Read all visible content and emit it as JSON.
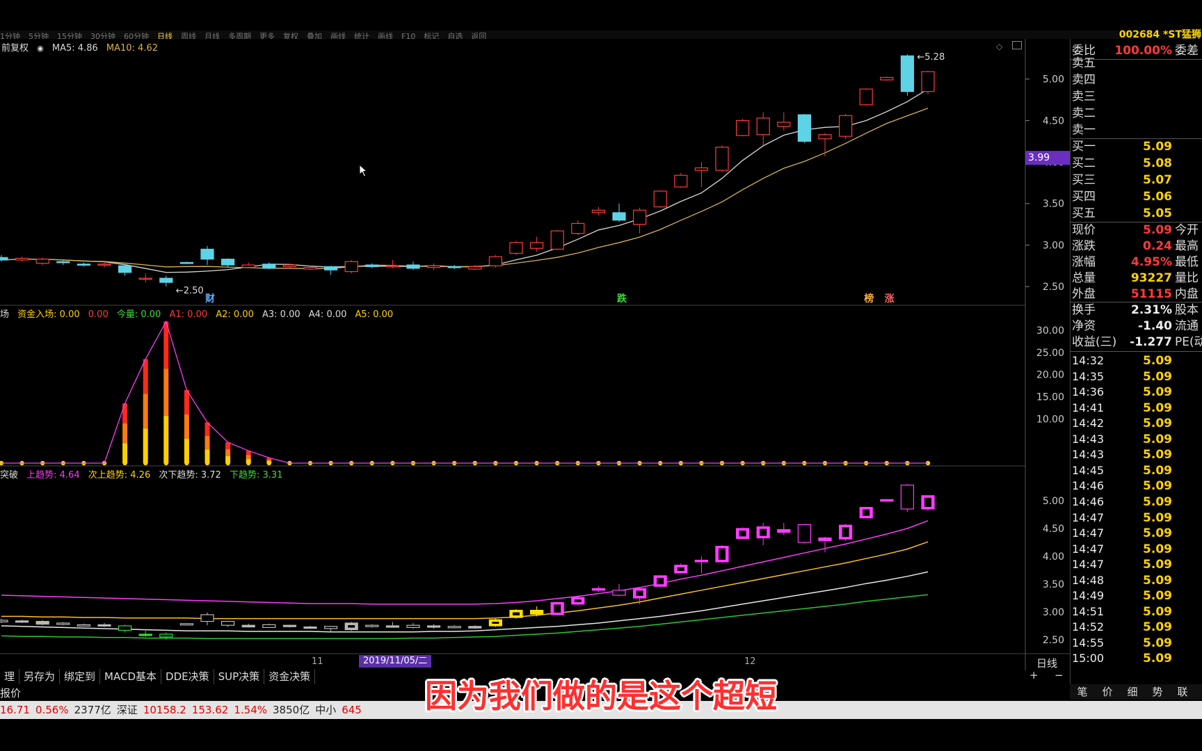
{
  "app": {
    "toolbar_left": [
      "1分钟",
      "5分钟",
      "15分钟",
      "30分钟",
      "60分钟",
      "日线",
      "周线",
      "月线",
      "多周期",
      "更多"
    ],
    "toolbar_active": "日线",
    "toolbar_right": [
      "复权",
      "叠加",
      "画线",
      "统计",
      "画线",
      "F10",
      "标记",
      "自选",
      "返回"
    ],
    "stock_code": "002684 *ST猛狮"
  },
  "colors": {
    "up": "#ff3b3b",
    "down": "#5fd3e6",
    "ma5": "#d8d8d8",
    "ma10": "#d9b44a",
    "magenta": "#ff3bff",
    "yellow": "#ffe000",
    "bg": "#000000"
  },
  "main_panel": {
    "legend": {
      "mode": "前复权",
      "ma5": "MA5: 4.86",
      "ma10": "MA10: 4.62"
    },
    "yaxis": [
      "5.00",
      "4.50",
      "4.00",
      "3.50",
      "3.00",
      "2.50"
    ],
    "high_label": "5.28",
    "low_label": "2.50",
    "current_price_tag": "3.99",
    "event_markers": [
      "财",
      "跌",
      "榜",
      "涨"
    ]
  },
  "money_panel": {
    "legend": {
      "prefix": "场",
      "a": "资金入场: 0.00",
      "b": "0.00",
      "c": "今量: 0.00",
      "a1": "A1: 0.00",
      "a2": "A2: 0.00",
      "a3": "A3: 0.00",
      "a4": "A4: 0.00",
      "a5": "A5: 0.00"
    },
    "yaxis": [
      "30.00",
      "25.00",
      "20.00",
      "15.00",
      "10.00"
    ]
  },
  "trend_panel": {
    "legend": {
      "prefix": "突破",
      "up": "上趋势: 4.64",
      "up2": "次上趋势: 4.26",
      "down2": "次下趋势: 3.72",
      "down": "下趋势: 3.31"
    },
    "yaxis": [
      "5.00",
      "4.50",
      "4.00",
      "3.50",
      "3.00",
      "2.50"
    ]
  },
  "xaxis": {
    "m11": "11",
    "m12": "12",
    "date_tag": "2019/11/05/二",
    "period": "日线"
  },
  "tabs": [
    "理",
    "另存为",
    "绑定到",
    "MACD基本",
    "DDE决策",
    "SUP决策",
    "资金决策"
  ],
  "zoom": [
    "+",
    "−"
  ],
  "bottom_left_label": "报价",
  "side": {
    "weibi": {
      "label": "委比",
      "value": "100.00%",
      "extra": "委差"
    },
    "sell": [
      {
        "label": "卖五",
        "price": ""
      },
      {
        "label": "卖四",
        "price": ""
      },
      {
        "label": "卖三",
        "price": ""
      },
      {
        "label": "卖二",
        "price": ""
      },
      {
        "label": "卖一",
        "price": ""
      }
    ],
    "buy": [
      {
        "label": "买一",
        "price": "5.09"
      },
      {
        "label": "买二",
        "price": "5.08"
      },
      {
        "label": "买三",
        "price": "5.07"
      },
      {
        "label": "买四",
        "price": "5.06"
      },
      {
        "label": "买五",
        "price": "5.05"
      }
    ],
    "quote": [
      {
        "label": "现价",
        "value": "5.09",
        "extra": "今开",
        "color": "#ff3b3b"
      },
      {
        "label": "涨跌",
        "value": "0.24",
        "extra": "最高",
        "color": "#ff3b3b"
      },
      {
        "label": "涨幅",
        "value": "4.95%",
        "extra": "最低",
        "color": "#ff3b3b"
      },
      {
        "label": "总量",
        "value": "93227",
        "extra": "量比",
        "color": "#ffd400"
      },
      {
        "label": "外盘",
        "value": "51115",
        "extra": "内盘",
        "color": "#ff3b3b"
      }
    ],
    "stats": [
      {
        "label": "换手",
        "value": "2.31%",
        "extra": "股本",
        "color": "#eeeeee"
      },
      {
        "label": "净资",
        "value": "-1.40",
        "extra": "流通",
        "color": "#eeeeee"
      },
      {
        "label": "收益(三)",
        "value": "-1.277",
        "extra": "PE(动",
        "color": "#eeeeee"
      }
    ],
    "trades": [
      {
        "time": "14:32",
        "price": "5.09"
      },
      {
        "time": "14:35",
        "price": "5.09"
      },
      {
        "time": "14:36",
        "price": "5.09"
      },
      {
        "time": "14:41",
        "price": "5.09"
      },
      {
        "time": "14:42",
        "price": "5.09"
      },
      {
        "time": "14:43",
        "price": "5.09"
      },
      {
        "time": "14:43",
        "price": "5.09"
      },
      {
        "time": "14:45",
        "price": "5.09"
      },
      {
        "time": "14:46",
        "price": "5.09"
      },
      {
        "time": "14:46",
        "price": "5.09"
      },
      {
        "time": "14:47",
        "price": "5.09"
      },
      {
        "time": "14:47",
        "price": "5.09"
      },
      {
        "time": "14:47",
        "price": "5.09"
      },
      {
        "time": "14:47",
        "price": "5.09"
      },
      {
        "time": "14:48",
        "price": "5.09"
      },
      {
        "time": "14:49",
        "price": "5.09"
      },
      {
        "time": "14:51",
        "price": "5.09"
      },
      {
        "time": "14:52",
        "price": "5.09"
      },
      {
        "time": "14:55",
        "price": "5.09"
      },
      {
        "time": "15:00",
        "price": "5.09"
      }
    ],
    "bottom_tabs": [
      "笔",
      "价",
      "细",
      "势",
      "联"
    ]
  },
  "ticker": [
    {
      "text": "16.71",
      "color": "#e00000"
    },
    {
      "text": "0.56%",
      "color": "#e00000"
    },
    {
      "text": "2377亿",
      "color": "#222222"
    },
    {
      "text": "深证",
      "color": "#222222"
    },
    {
      "text": "10158.2",
      "color": "#e00000"
    },
    {
      "text": "153.62",
      "color": "#e00000"
    },
    {
      "text": "1.54%",
      "color": "#e00000"
    },
    {
      "text": "3850亿",
      "color": "#222222"
    },
    {
      "text": "中小",
      "color": "#222222"
    },
    {
      "text": "645",
      "color": "#e00000"
    }
  ],
  "subtitle": "因为我们做的是这个超短",
  "chart_data": {
    "type": "candlestick",
    "ylim": [
      2.4,
      5.4
    ],
    "candles": [
      {
        "o": 2.85,
        "c": 2.82,
        "h": 2.88,
        "l": 2.8
      },
      {
        "o": 2.82,
        "c": 2.84,
        "h": 2.86,
        "l": 2.8
      },
      {
        "o": 2.78,
        "c": 2.83,
        "h": 2.85,
        "l": 2.76
      },
      {
        "o": 2.8,
        "c": 2.79,
        "h": 2.82,
        "l": 2.76
      },
      {
        "o": 2.77,
        "c": 2.76,
        "h": 2.79,
        "l": 2.74
      },
      {
        "o": 2.76,
        "c": 2.77,
        "h": 2.8,
        "l": 2.73
      },
      {
        "o": 2.75,
        "c": 2.67,
        "h": 2.77,
        "l": 2.63
      },
      {
        "o": 2.6,
        "c": 2.6,
        "h": 2.66,
        "l": 2.55
      },
      {
        "o": 2.6,
        "c": 2.55,
        "h": 2.63,
        "l": 2.5
      },
      {
        "o": 2.79,
        "c": 2.78,
        "h": 2.8,
        "l": 2.78
      },
      {
        "o": 2.95,
        "c": 2.83,
        "h": 2.99,
        "l": 2.76
      },
      {
        "o": 2.83,
        "c": 2.76,
        "h": 2.84,
        "l": 2.73
      },
      {
        "o": 2.73,
        "c": 2.76,
        "h": 2.79,
        "l": 2.72
      },
      {
        "o": 2.77,
        "c": 2.72,
        "h": 2.79,
        "l": 2.71
      },
      {
        "o": 2.74,
        "c": 2.76,
        "h": 2.77,
        "l": 2.72
      },
      {
        "o": 2.71,
        "c": 2.73,
        "h": 2.75,
        "l": 2.7
      },
      {
        "o": 2.74,
        "c": 2.7,
        "h": 2.75,
        "l": 2.64
      },
      {
        "o": 2.68,
        "c": 2.8,
        "h": 2.82,
        "l": 2.66
      },
      {
        "o": 2.76,
        "c": 2.74,
        "h": 2.78,
        "l": 2.72
      },
      {
        "o": 2.75,
        "c": 2.75,
        "h": 2.82,
        "l": 2.72
      },
      {
        "o": 2.76,
        "c": 2.72,
        "h": 2.8,
        "l": 2.7
      },
      {
        "o": 2.73,
        "c": 2.75,
        "h": 2.78,
        "l": 2.7
      },
      {
        "o": 2.74,
        "c": 2.73,
        "h": 2.76,
        "l": 2.71
      },
      {
        "o": 2.71,
        "c": 2.74,
        "h": 2.76,
        "l": 2.7
      },
      {
        "o": 2.75,
        "c": 2.86,
        "h": 2.88,
        "l": 2.73
      },
      {
        "o": 2.9,
        "c": 3.03,
        "h": 3.05,
        "l": 2.88
      },
      {
        "o": 2.96,
        "c": 3.03,
        "h": 3.1,
        "l": 2.92
      },
      {
        "o": 2.95,
        "c": 3.17,
        "h": 3.18,
        "l": 2.94
      },
      {
        "o": 3.14,
        "c": 3.26,
        "h": 3.3,
        "l": 3.12
      },
      {
        "o": 3.39,
        "c": 3.42,
        "h": 3.46,
        "l": 3.36
      },
      {
        "o": 3.39,
        "c": 3.3,
        "h": 3.5,
        "l": 3.28
      },
      {
        "o": 3.25,
        "c": 3.42,
        "h": 3.45,
        "l": 3.14
      },
      {
        "o": 3.46,
        "c": 3.65,
        "h": 3.66,
        "l": 3.45
      },
      {
        "o": 3.7,
        "c": 3.84,
        "h": 3.87,
        "l": 3.69
      },
      {
        "o": 3.9,
        "c": 3.93,
        "h": 4.0,
        "l": 3.7
      },
      {
        "o": 3.9,
        "c": 4.18,
        "h": 4.2,
        "l": 3.88
      },
      {
        "o": 4.32,
        "c": 4.5,
        "h": 4.52,
        "l": 4.31
      },
      {
        "o": 4.33,
        "c": 4.53,
        "h": 4.6,
        "l": 4.2
      },
      {
        "o": 4.43,
        "c": 4.48,
        "h": 4.6,
        "l": 4.38
      },
      {
        "o": 4.57,
        "c": 4.25,
        "h": 4.58,
        "l": 4.23
      },
      {
        "o": 4.28,
        "c": 4.33,
        "h": 4.35,
        "l": 4.07
      },
      {
        "o": 4.31,
        "c": 4.56,
        "h": 4.58,
        "l": 4.28
      },
      {
        "o": 4.69,
        "c": 4.88,
        "h": 4.89,
        "l": 4.68
      },
      {
        "o": 4.99,
        "c": 5.02,
        "h": 5.03,
        "l": 4.98
      },
      {
        "o": 5.28,
        "c": 4.85,
        "h": 5.3,
        "l": 4.8
      },
      {
        "o": 4.85,
        "c": 5.09,
        "h": 5.1,
        "l": 4.82
      }
    ],
    "money_values": [
      0,
      0,
      0,
      0,
      0,
      0,
      13.5,
      23.5,
      32,
      16.5,
      9.2,
      4.7,
      2.8,
      1.2,
      0,
      0,
      0,
      0,
      0,
      0,
      0,
      0,
      0,
      0,
      0,
      0,
      0,
      0,
      0,
      0,
      0,
      0,
      0,
      0,
      0,
      0,
      0,
      0,
      0,
      0,
      0,
      0,
      0,
      0,
      0,
      0
    ],
    "trend_lines": {
      "up_trend": [
        3.3,
        3.29,
        3.28,
        3.27,
        3.26,
        3.25,
        3.24,
        3.23,
        3.22,
        3.21,
        3.2,
        3.19,
        3.18,
        3.17,
        3.16,
        3.15,
        3.15,
        3.15,
        3.14,
        3.14,
        3.14,
        3.14,
        3.14,
        3.14,
        3.15,
        3.17,
        3.2,
        3.24,
        3.28,
        3.33,
        3.38,
        3.44,
        3.51,
        3.59,
        3.66,
        3.74,
        3.82,
        3.9,
        3.98,
        4.06,
        4.14,
        4.22,
        4.31,
        4.4,
        4.5,
        4.64
      ],
      "up2_trend": [
        2.92,
        2.92,
        2.91,
        2.91,
        2.9,
        2.9,
        2.89,
        2.89,
        2.89,
        2.89,
        2.88,
        2.88,
        2.88,
        2.88,
        2.88,
        2.88,
        2.88,
        2.88,
        2.88,
        2.88,
        2.88,
        2.88,
        2.88,
        2.88,
        2.89,
        2.91,
        2.94,
        2.98,
        3.02,
        3.07,
        3.12,
        3.18,
        3.25,
        3.32,
        3.39,
        3.46,
        3.53,
        3.6,
        3.67,
        3.74,
        3.81,
        3.88,
        3.96,
        4.04,
        4.13,
        4.26
      ],
      "down2_trend": [
        2.75,
        2.74,
        2.73,
        2.72,
        2.71,
        2.7,
        2.69,
        2.68,
        2.67,
        2.66,
        2.66,
        2.66,
        2.65,
        2.65,
        2.65,
        2.65,
        2.64,
        2.64,
        2.64,
        2.64,
        2.64,
        2.65,
        2.65,
        2.66,
        2.68,
        2.7,
        2.72,
        2.74,
        2.77,
        2.8,
        2.84,
        2.88,
        2.92,
        2.97,
        3.02,
        3.08,
        3.14,
        3.2,
        3.26,
        3.32,
        3.38,
        3.44,
        3.51,
        3.57,
        3.64,
        3.72
      ],
      "down_trend": [
        2.57,
        2.56,
        2.56,
        2.55,
        2.55,
        2.54,
        2.54,
        2.53,
        2.53,
        2.53,
        2.52,
        2.52,
        2.52,
        2.52,
        2.52,
        2.52,
        2.52,
        2.52,
        2.52,
        2.52,
        2.53,
        2.53,
        2.54,
        2.55,
        2.56,
        2.58,
        2.6,
        2.62,
        2.65,
        2.68,
        2.71,
        2.74,
        2.78,
        2.82,
        2.86,
        2.9,
        2.94,
        2.98,
        3.02,
        3.06,
        3.1,
        3.14,
        3.19,
        3.23,
        3.27,
        3.31
      ]
    }
  }
}
